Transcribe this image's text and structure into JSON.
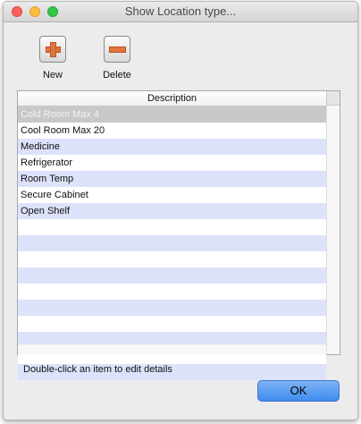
{
  "window": {
    "title": "Show Location type..."
  },
  "toolbar": {
    "new_label": "New",
    "delete_label": "Delete"
  },
  "table": {
    "column": "Description",
    "rows": [
      "Cold Room Max 4",
      "Cool Room Max 20",
      "Medicine",
      "Refrigerator",
      "Room Temp",
      "Secure Cabinet",
      "Open Shelf",
      "",
      "",
      "",
      "",
      "",
      "",
      "",
      "",
      "",
      ""
    ],
    "selected_index": 0
  },
  "footer": {
    "hint": "Double-click an item to edit details",
    "ok_label": "OK"
  },
  "colors": {
    "accent": "#3e8cee",
    "row_alt": "#dde2fb",
    "selected": "#c8c8c8"
  }
}
